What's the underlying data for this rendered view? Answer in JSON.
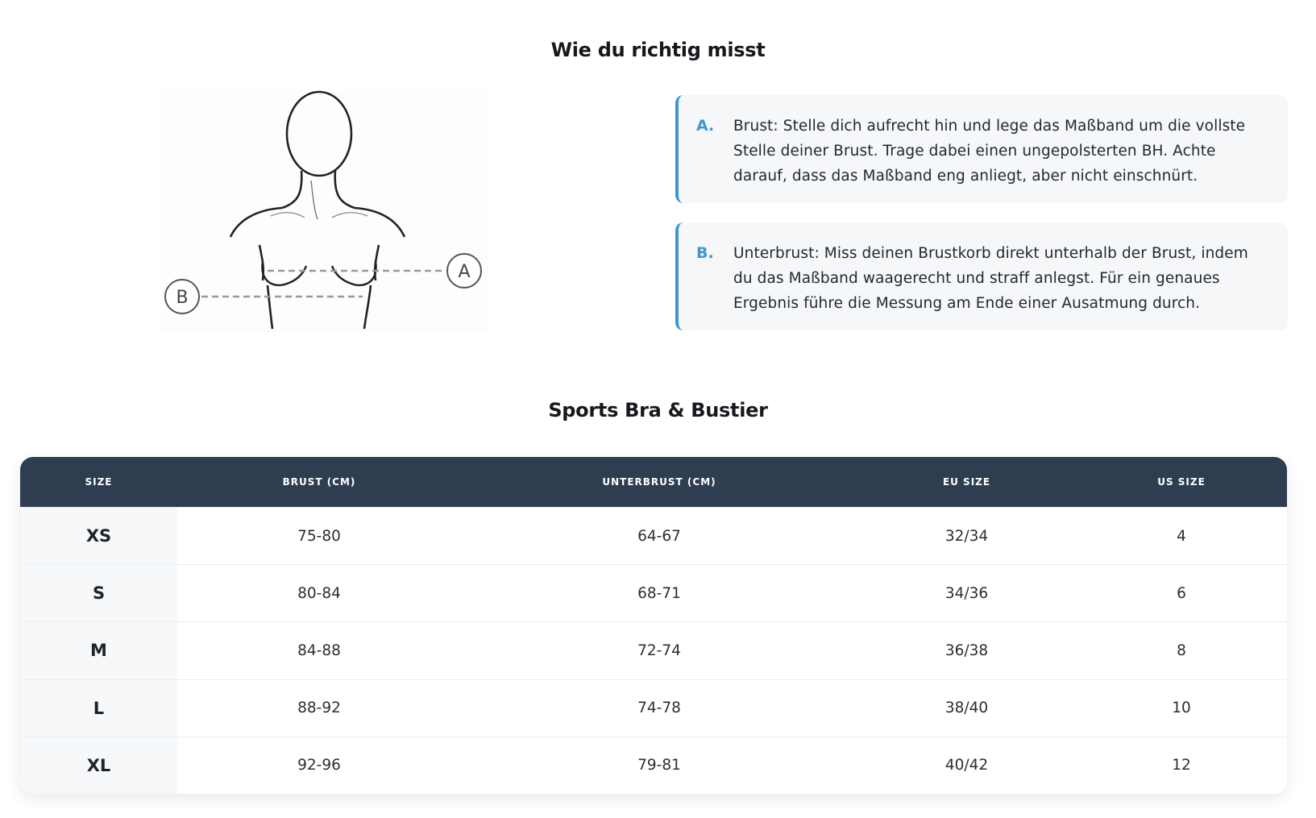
{
  "measure_section": {
    "title": "Wie du richtig misst",
    "illustration": {
      "marker_a": "A",
      "marker_b": "B"
    },
    "instructions": [
      {
        "letter": "A.",
        "text": "Brust: Stelle dich aufrecht hin und lege das Maßband um die vollste Stelle deiner Brust. Trage dabei einen ungepolsterten BH. Achte darauf, dass das Maßband eng anliegt, aber nicht einschnürt."
      },
      {
        "letter": "B.",
        "text": "Unterbrust: Miss deinen Brustkorb direkt unterhalb der Brust, indem du das Maßband waagerecht und straff anlegst. Für ein genaues Ergebnis führe die Messung am Ende einer Ausatmung durch."
      }
    ]
  },
  "size_table": {
    "title": "Sports Bra & Bustier",
    "columns": [
      "SIZE",
      "BRUST (CM)",
      "UNTERBRUST (CM)",
      "EU SIZE",
      "US SIZE"
    ],
    "rows": [
      [
        "XS",
        "75-80",
        "64-67",
        "32/34",
        "4"
      ],
      [
        "S",
        "80-84",
        "68-71",
        "34/36",
        "6"
      ],
      [
        "M",
        "84-88",
        "72-74",
        "36/38",
        "8"
      ],
      [
        "L",
        "88-92",
        "74-78",
        "38/40",
        "10"
      ],
      [
        "XL",
        "92-96",
        "79-81",
        "40/42",
        "12"
      ]
    ]
  },
  "colors": {
    "accent": "#3e97d1",
    "table_header_bg": "#2e3e50",
    "card_bg": "#f5f7f9"
  }
}
